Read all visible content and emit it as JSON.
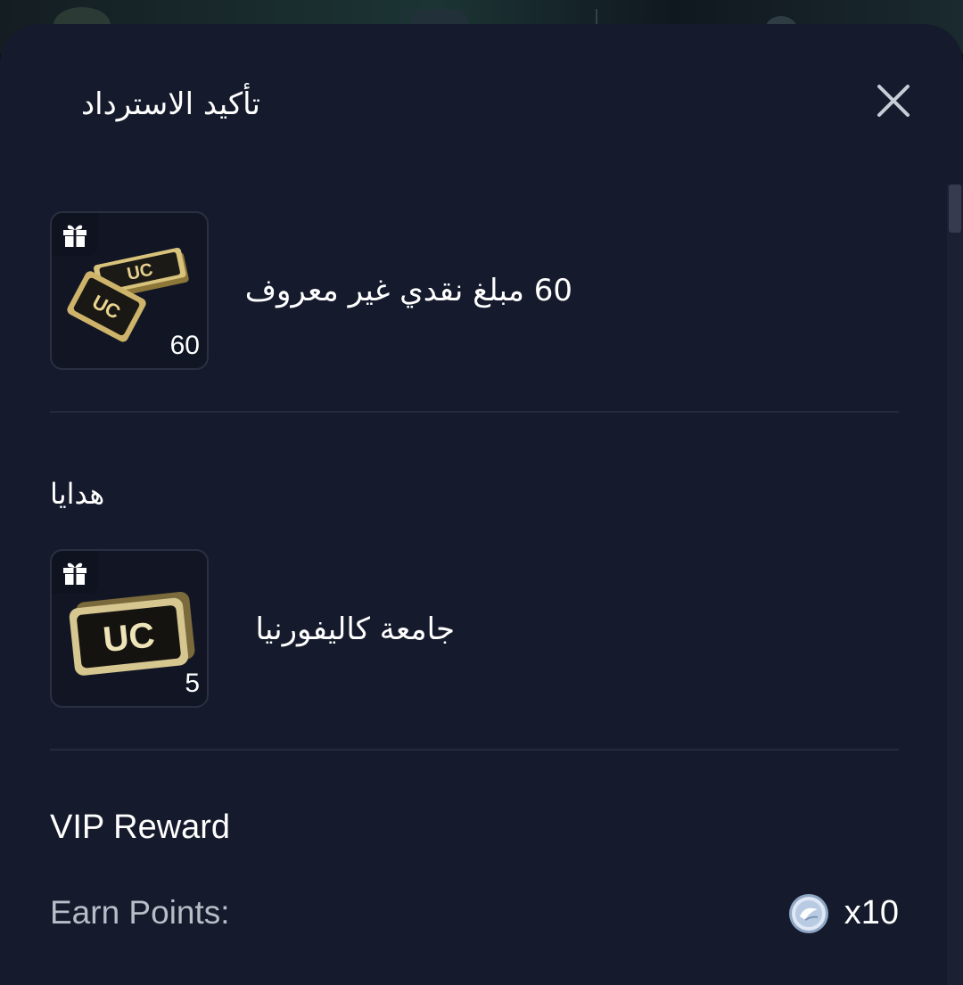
{
  "modal": {
    "title": "تأكيد الاسترداد"
  },
  "items": [
    {
      "label": "60 مبلغ نقدي غير معروف",
      "quantity": "60",
      "image": "uc-cash-stack",
      "badge_icon": "gift-icon"
    }
  ],
  "gifts": {
    "heading": "هدايا",
    "items": [
      {
        "label": "جامعة كاليفورنيا",
        "quantity": "5",
        "image": "uc-cash-stack",
        "badge_icon": "gift-icon"
      }
    ]
  },
  "vip": {
    "title": "VIP Reward",
    "earn_label": "Earn Points:",
    "earn_value": "x10",
    "points_icon": "points-coin-icon"
  },
  "colors": {
    "sheet_background": "#151a2c",
    "text_primary": "#ffffff",
    "text_secondary": "#b9bdc8",
    "divider": "#252b3c"
  }
}
